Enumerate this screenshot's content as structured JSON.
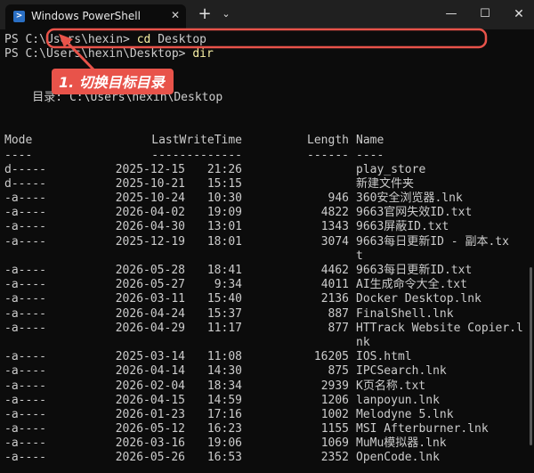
{
  "window": {
    "tab_title": "Windows PowerShell",
    "tab_close": "✕",
    "new_tab": "+",
    "tab_menu": "⌄",
    "minimize": "—",
    "maximize": "☐",
    "close": "✕",
    "ps_icon_glyph": ">"
  },
  "prompt1": {
    "prefix": "PS C:\\Users\\hexin> ",
    "command": "cd",
    "arg": " Desktop"
  },
  "prompt2": {
    "prefix": "PS C:\\Users\\hexin\\Desktop> ",
    "command": "dir"
  },
  "directory_line": "    目录: C:\\Users\\hexin\\Desktop",
  "table_header": {
    "mode": "Mode",
    "lastwritetime": "LastWriteTime",
    "length": "Length",
    "name": "Name"
  },
  "table_rule": {
    "mode": "----",
    "lastwritetime": "-------------",
    "length": "------",
    "name": "----"
  },
  "files": [
    {
      "mode": "d-----",
      "date": "2025-12-15",
      "time": "21:26",
      "length": "",
      "name": "play_store"
    },
    {
      "mode": "d-----",
      "date": "2025-10-21",
      "time": "15:15",
      "length": "",
      "name": "新建文件夹"
    },
    {
      "mode": "-a----",
      "date": "2025-10-24",
      "time": "10:30",
      "length": "946",
      "name": "360安全浏览器.lnk"
    },
    {
      "mode": "-a----",
      "date": "2026-04-02",
      "time": "19:09",
      "length": "4822",
      "name": "9663官网失效ID.txt"
    },
    {
      "mode": "-a----",
      "date": "2026-04-30",
      "time": "13:01",
      "length": "1343",
      "name": "9663屏蔽ID.txt"
    },
    {
      "mode": "-a----",
      "date": "2025-12-19",
      "time": "18:01",
      "length": "3074",
      "name": "9663每日更新ID - 副本.tx",
      "name_cont": "t"
    },
    {
      "mode": "-a----",
      "date": "2026-05-28",
      "time": "18:41",
      "length": "4462",
      "name": "9663每日更新ID.txt"
    },
    {
      "mode": "-a----",
      "date": "2026-05-27",
      "time": "9:34",
      "length": "4011",
      "name": "AI生成命令大全.txt"
    },
    {
      "mode": "-a----",
      "date": "2026-03-11",
      "time": "15:40",
      "length": "2136",
      "name": "Docker Desktop.lnk"
    },
    {
      "mode": "-a----",
      "date": "2026-04-24",
      "time": "15:37",
      "length": "887",
      "name": "FinalShell.lnk"
    },
    {
      "mode": "-a----",
      "date": "2026-04-29",
      "time": "11:17",
      "length": "877",
      "name": "HTTrack Website Copier.l",
      "name_cont": "nk"
    },
    {
      "mode": "-a----",
      "date": "2025-03-14",
      "time": "11:08",
      "length": "16205",
      "name": "IOS.html"
    },
    {
      "mode": "-a----",
      "date": "2026-04-14",
      "time": "14:30",
      "length": "875",
      "name": "IPCSearch.lnk"
    },
    {
      "mode": "-a----",
      "date": "2026-02-04",
      "time": "18:34",
      "length": "2939",
      "name": "K页名称.txt"
    },
    {
      "mode": "-a----",
      "date": "2026-04-15",
      "time": "14:59",
      "length": "1206",
      "name": "lanpoyun.lnk"
    },
    {
      "mode": "-a----",
      "date": "2026-01-23",
      "time": "17:16",
      "length": "1002",
      "name": "Melodyne 5.lnk"
    },
    {
      "mode": "-a----",
      "date": "2026-05-12",
      "time": "16:23",
      "length": "1155",
      "name": "MSI Afterburner.lnk"
    },
    {
      "mode": "-a----",
      "date": "2026-03-16",
      "time": "19:06",
      "length": "1069",
      "name": "MuMu模拟器.lnk"
    },
    {
      "mode": "-a----",
      "date": "2026-05-26",
      "time": "16:53",
      "length": "2352",
      "name": "OpenCode.lnk"
    }
  ],
  "annotation": {
    "label": "1. 切换目标目录",
    "color": "#e8534a"
  },
  "colors": {
    "background": "#0c0c0c",
    "text": "#cccccc",
    "command": "#f9f1a5",
    "titlebar": "#202020"
  }
}
